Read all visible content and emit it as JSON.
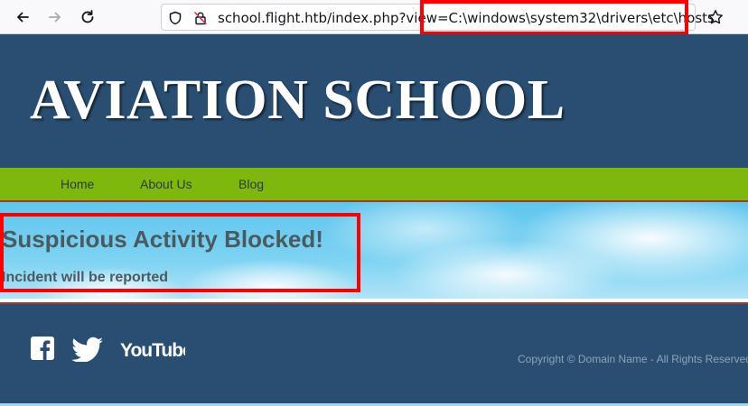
{
  "browser": {
    "back_icon": "arrow-left-icon",
    "forward_icon": "arrow-right-icon",
    "reload_icon": "reload-icon",
    "tracking_icon": "shield-icon",
    "security_icon": "insecure-lock-icon",
    "bookmark_icon": "star-icon",
    "url_host": "school.flight.htb",
    "url_path": "/index.php?view=C:\\windows\\system32\\drivers\\etc\\hosts"
  },
  "site": {
    "logo": "AVIATION SCHOOL",
    "nav": [
      {
        "label": "Home"
      },
      {
        "label": "About Us"
      },
      {
        "label": "Blog"
      }
    ],
    "alert": {
      "title": "Suspicious Activity Blocked!",
      "subtitle": "Incident will be reported"
    },
    "footer": {
      "social": [
        {
          "name": "facebook-icon"
        },
        {
          "name": "twitter-icon"
        },
        {
          "name": "youtube-icon",
          "label": "YouTube"
        }
      ],
      "copyright": "Copyright © Domain Name - All Rights Reserved"
    }
  },
  "colors": {
    "header_bg": "#294e72",
    "nav_bg": "#7fb80d",
    "highlight": "#ff0000"
  }
}
